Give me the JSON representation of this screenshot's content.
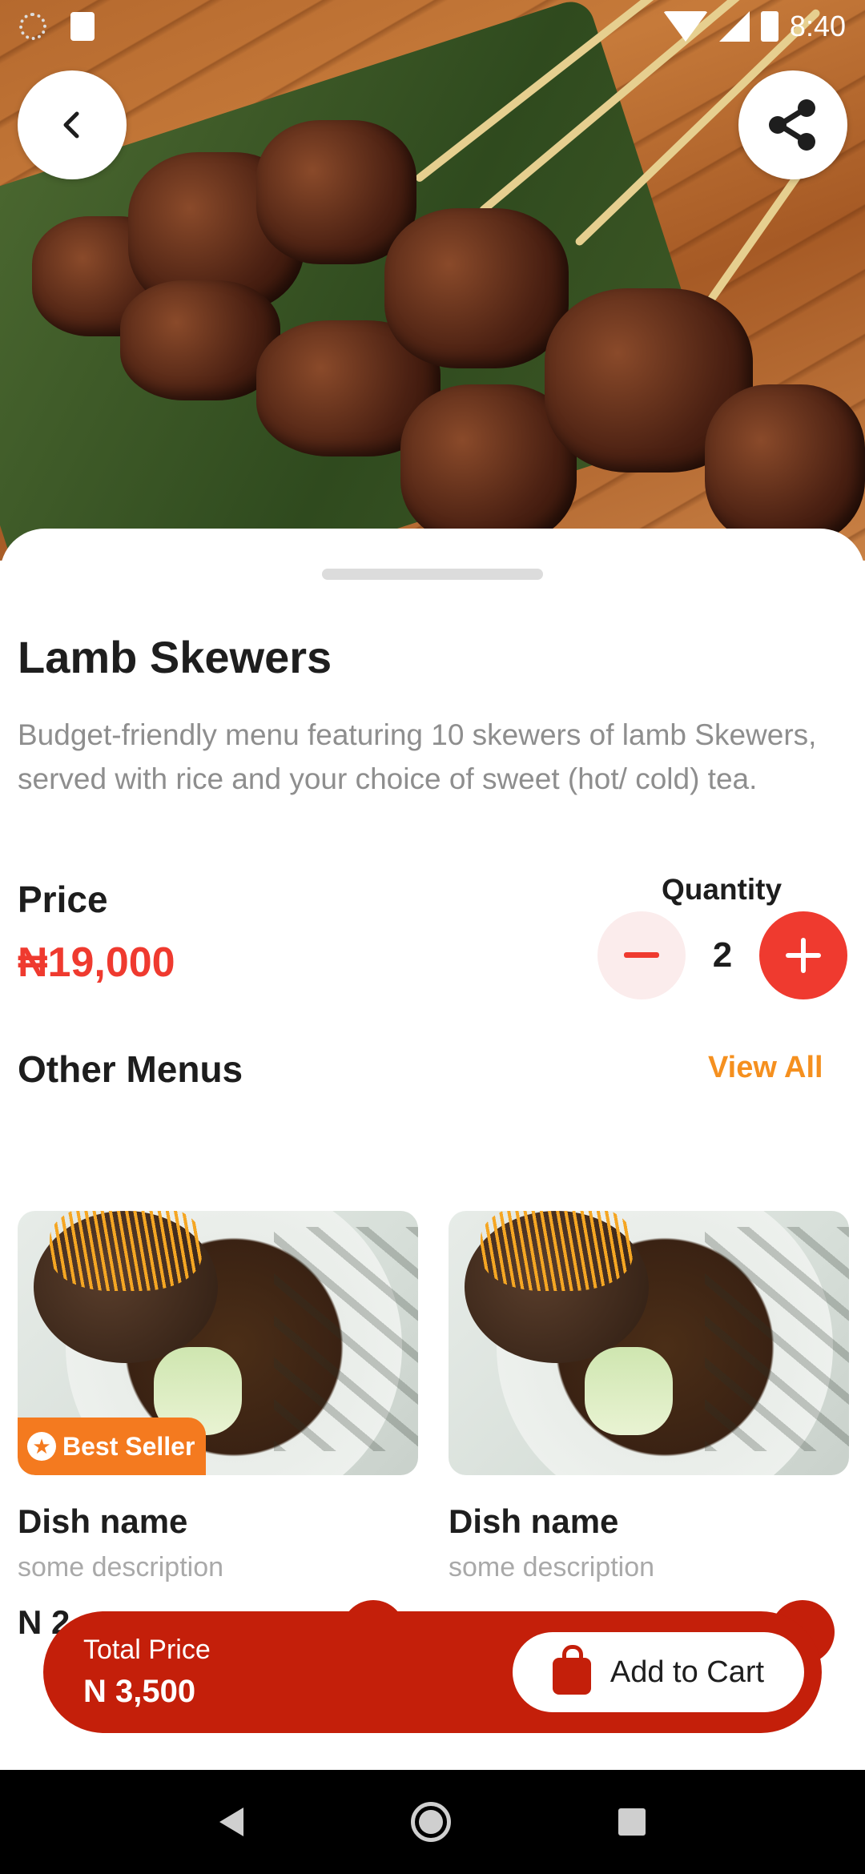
{
  "status_bar": {
    "time": "8:40"
  },
  "product": {
    "name": "Lamb Skewers",
    "description": "Budget-friendly menu featuring 10 skewers of lamb Skewers, served with rice and your choice of sweet (hot/ cold) tea.",
    "price_label": "Price",
    "price": "₦19,000",
    "quantity_label": "Quantity",
    "quantity": "2"
  },
  "other_menus": {
    "title": "Other Menus",
    "view_all": "View All",
    "items": [
      {
        "name": "Dish name",
        "description": "some description",
        "price": "N 2",
        "badge": "Best Seller"
      },
      {
        "name": "Dish name",
        "description": "some description"
      }
    ]
  },
  "cart": {
    "total_label": "Total Price",
    "total_value": "N 3,500",
    "add_button": "Add to Cart"
  },
  "icons": {
    "back": "back-arrow-icon",
    "share": "share-icon",
    "minus": "minus-icon",
    "plus": "plus-icon",
    "bag": "shopping-bag-icon",
    "star": "star-icon"
  },
  "colors": {
    "accent_red": "#ef3a2f",
    "cart_red": "#c41f0a",
    "view_all_orange": "#f5901f",
    "badge_orange": "#f47a1f"
  }
}
